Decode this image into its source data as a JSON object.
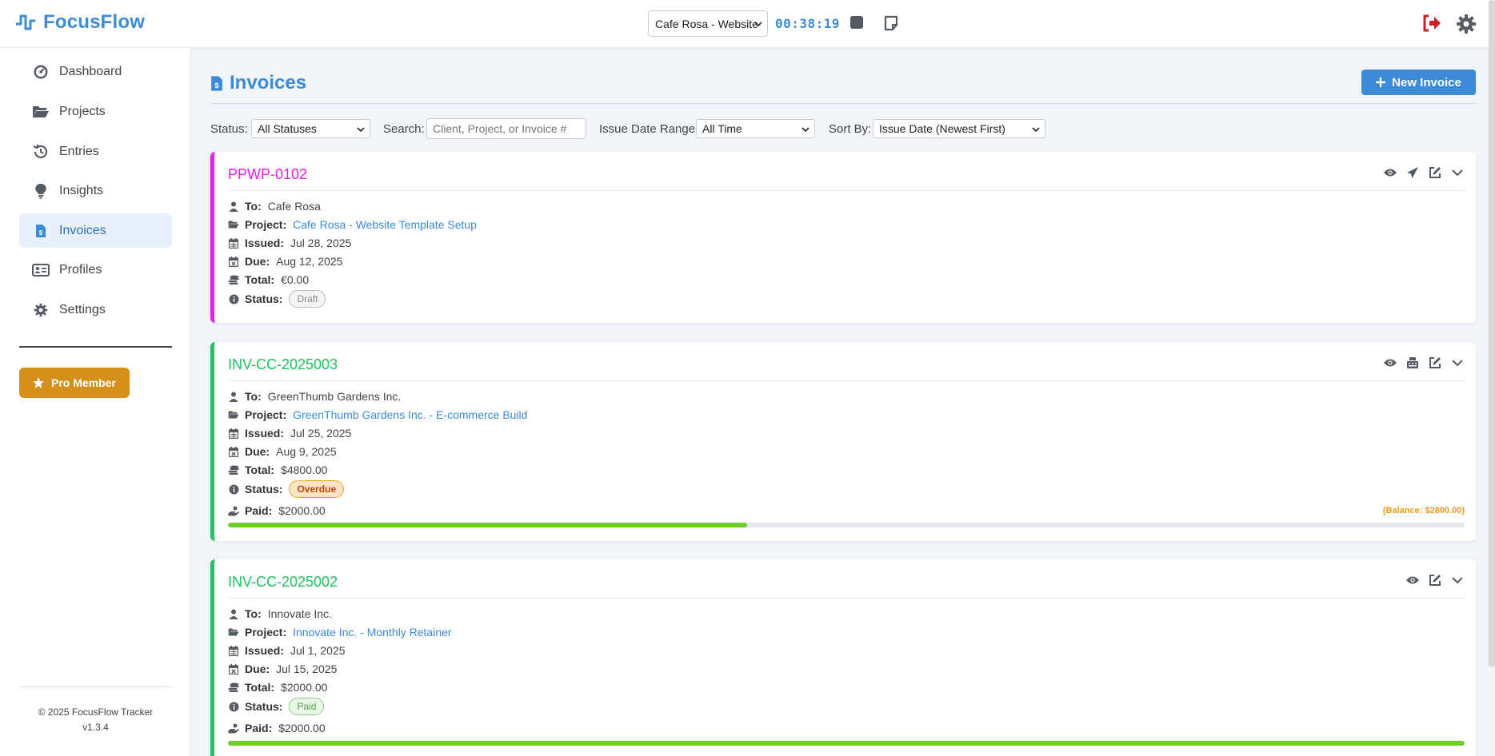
{
  "header": {
    "app_name": "FocusFlow",
    "project_select_value": "Cafe Rosa - Website",
    "timer": "00:38:19",
    "icons": [
      "stop-icon",
      "note-icon",
      "logout-icon",
      "gear-icon"
    ]
  },
  "sidebar": {
    "items": [
      {
        "label": "Dashboard",
        "icon": "dashboard-icon"
      },
      {
        "label": "Projects",
        "icon": "folder-icon"
      },
      {
        "label": "Entries",
        "icon": "history-icon"
      },
      {
        "label": "Insights",
        "icon": "lightbulb-icon"
      },
      {
        "label": "Invoices",
        "icon": "invoice-icon",
        "active": true
      },
      {
        "label": "Profiles",
        "icon": "id-card-icon"
      },
      {
        "label": "Settings",
        "icon": "gear-icon"
      }
    ],
    "pro_label": "Pro Member",
    "footer_copy": "© 2025 FocusFlow Tracker",
    "footer_version": "v1.3.4"
  },
  "main": {
    "title": "Invoices",
    "new_button": "New Invoice",
    "filters": {
      "status_label": "Status:",
      "status_value": "All Statuses",
      "search_label": "Search:",
      "search_placeholder": "Client, Project, or Invoice #",
      "date_label": "Issue Date Range:",
      "date_value": "All Time",
      "sort_label": "Sort By:",
      "sort_value": "Issue Date (Newest First)"
    },
    "labels": {
      "to": "To:",
      "project": "Project:",
      "issued": "Issued:",
      "due": "Due:",
      "total": "Total:",
      "status": "Status:",
      "paid": "Paid:"
    },
    "invoices": [
      {
        "id": "PPWP-0102",
        "to": "Cafe Rosa",
        "project": "Cafe Rosa - Website Template Setup",
        "issued": "Jul 28, 2025",
        "due": "Aug 12, 2025",
        "total": "€0.00",
        "status": "Draft",
        "accent": "#e91ee3"
      },
      {
        "id": "INV-CC-2025003",
        "to": "GreenThumb Gardens Inc.",
        "project": "GreenThumb Gardens Inc. - E-commerce Build",
        "issued": "Jul 25, 2025",
        "due": "Aug 9, 2025",
        "total": "$4800.00",
        "status": "Overdue",
        "paid": "$2000.00",
        "balance": "(Balance: $2800.00)",
        "paid_fraction": 0.42,
        "accent": "#21c25e"
      },
      {
        "id": "INV-CC-2025002",
        "to": "Innovate Inc.",
        "project": "Innovate Inc. - Monthly Retainer",
        "issued": "Jul 1, 2025",
        "due": "Jul 15, 2025",
        "total": "$2000.00",
        "status": "Paid",
        "paid": "$2000.00",
        "paid_fraction": 1.0,
        "accent": "#21c25e"
      }
    ]
  },
  "colors": {
    "brand": "#3b8bd8",
    "pro": "#d4901a",
    "danger": "#d11a2a",
    "progress": "#6fcd2b",
    "balance": "#e89b1c"
  }
}
